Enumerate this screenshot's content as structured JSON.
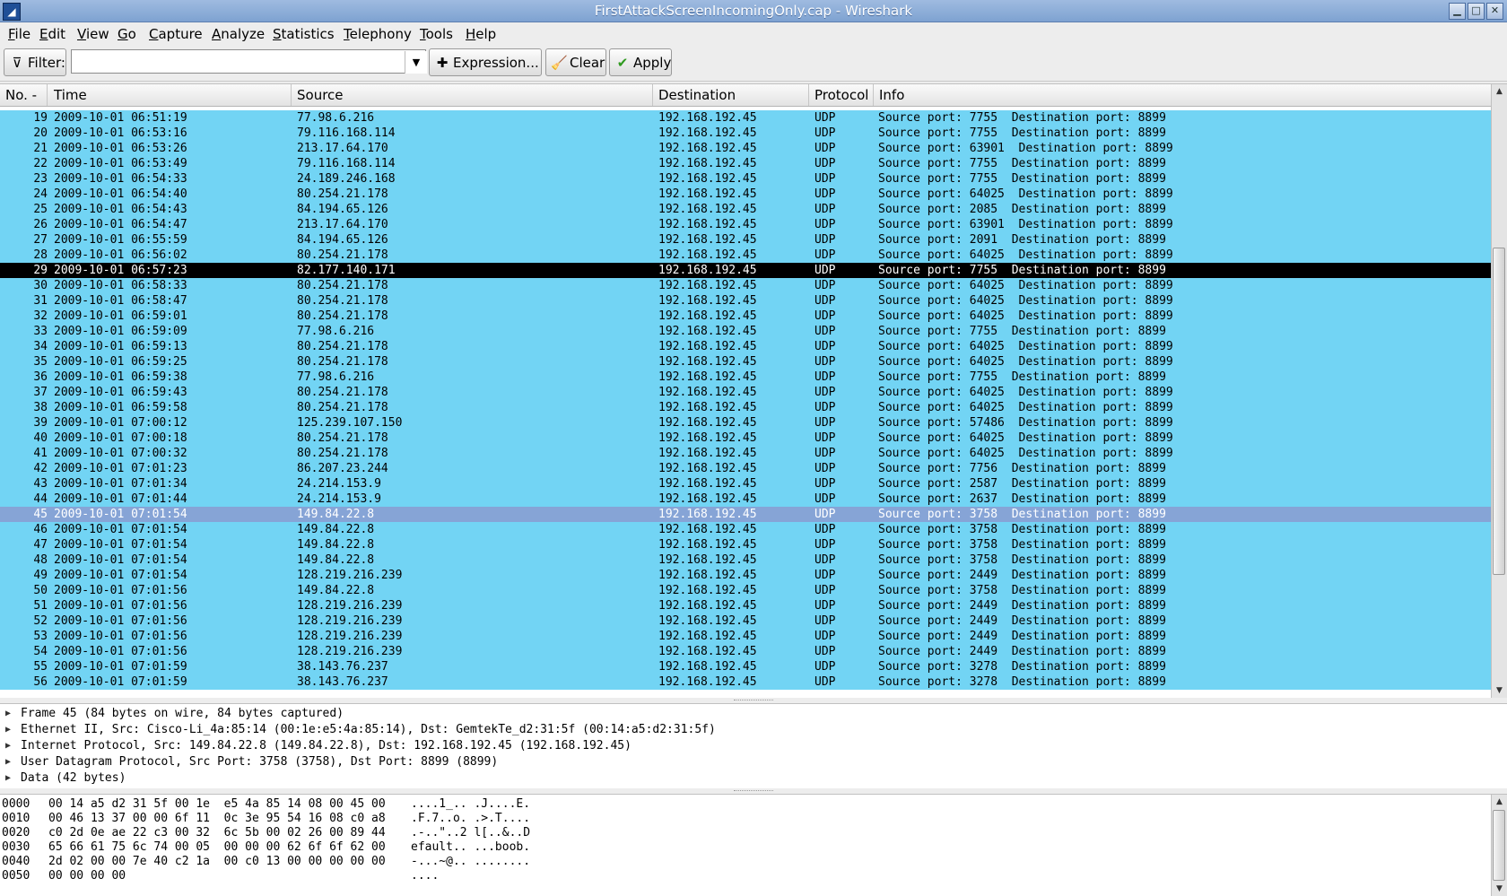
{
  "window": {
    "title": "FirstAttackScreenIncomingOnly.cap - Wireshark",
    "app_icon": "wireshark-icon",
    "buttons": [
      "minimize-icon",
      "maximize-icon",
      "close-icon"
    ]
  },
  "menu": [
    "File",
    "Edit",
    "View",
    "Go",
    "Capture",
    "Analyze",
    "Statistics",
    "Telephony",
    "Tools",
    "Help"
  ],
  "toolbar": {
    "filter_label": "Filter:",
    "filter_value": "",
    "expression_label": "Expression...",
    "clear_label": "Clear",
    "apply_label": "Apply"
  },
  "columns": [
    "No. -",
    "Time",
    "Source",
    "Destination",
    "Protocol",
    "Info"
  ],
  "colors": {
    "row": "#72d4f4",
    "selected": "#000000",
    "highlight": "#86a4d6"
  },
  "packets": [
    {
      "no": "19",
      "time": "2009-10-01 06:51:19",
      "src": "77.98.6.216",
      "dst": "192.168.192.45",
      "proto": "UDP",
      "info": "Source port: 7755  Destination port: 8899"
    },
    {
      "no": "20",
      "time": "2009-10-01 06:53:16",
      "src": "79.116.168.114",
      "dst": "192.168.192.45",
      "proto": "UDP",
      "info": "Source port: 7755  Destination port: 8899"
    },
    {
      "no": "21",
      "time": "2009-10-01 06:53:26",
      "src": "213.17.64.170",
      "dst": "192.168.192.45",
      "proto": "UDP",
      "info": "Source port: 63901  Destination port: 8899"
    },
    {
      "no": "22",
      "time": "2009-10-01 06:53:49",
      "src": "79.116.168.114",
      "dst": "192.168.192.45",
      "proto": "UDP",
      "info": "Source port: 7755  Destination port: 8899"
    },
    {
      "no": "23",
      "time": "2009-10-01 06:54:33",
      "src": "24.189.246.168",
      "dst": "192.168.192.45",
      "proto": "UDP",
      "info": "Source port: 7755  Destination port: 8899"
    },
    {
      "no": "24",
      "time": "2009-10-01 06:54:40",
      "src": "80.254.21.178",
      "dst": "192.168.192.45",
      "proto": "UDP",
      "info": "Source port: 64025  Destination port: 8899"
    },
    {
      "no": "25",
      "time": "2009-10-01 06:54:43",
      "src": "84.194.65.126",
      "dst": "192.168.192.45",
      "proto": "UDP",
      "info": "Source port: 2085  Destination port: 8899"
    },
    {
      "no": "26",
      "time": "2009-10-01 06:54:47",
      "src": "213.17.64.170",
      "dst": "192.168.192.45",
      "proto": "UDP",
      "info": "Source port: 63901  Destination port: 8899"
    },
    {
      "no": "27",
      "time": "2009-10-01 06:55:59",
      "src": "84.194.65.126",
      "dst": "192.168.192.45",
      "proto": "UDP",
      "info": "Source port: 2091  Destination port: 8899"
    },
    {
      "no": "28",
      "time": "2009-10-01 06:56:02",
      "src": "80.254.21.178",
      "dst": "192.168.192.45",
      "proto": "UDP",
      "info": "Source port: 64025  Destination port: 8899"
    },
    {
      "no": "29",
      "time": "2009-10-01 06:57:23",
      "src": "82.177.140.171",
      "dst": "192.168.192.45",
      "proto": "UDP",
      "info": "Source port: 7755  Destination port: 8899",
      "state": "sel"
    },
    {
      "no": "30",
      "time": "2009-10-01 06:58:33",
      "src": "80.254.21.178",
      "dst": "192.168.192.45",
      "proto": "UDP",
      "info": "Source port: 64025  Destination port: 8899"
    },
    {
      "no": "31",
      "time": "2009-10-01 06:58:47",
      "src": "80.254.21.178",
      "dst": "192.168.192.45",
      "proto": "UDP",
      "info": "Source port: 64025  Destination port: 8899"
    },
    {
      "no": "32",
      "time": "2009-10-01 06:59:01",
      "src": "80.254.21.178",
      "dst": "192.168.192.45",
      "proto": "UDP",
      "info": "Source port: 64025  Destination port: 8899"
    },
    {
      "no": "33",
      "time": "2009-10-01 06:59:09",
      "src": "77.98.6.216",
      "dst": "192.168.192.45",
      "proto": "UDP",
      "info": "Source port: 7755  Destination port: 8899"
    },
    {
      "no": "34",
      "time": "2009-10-01 06:59:13",
      "src": "80.254.21.178",
      "dst": "192.168.192.45",
      "proto": "UDP",
      "info": "Source port: 64025  Destination port: 8899"
    },
    {
      "no": "35",
      "time": "2009-10-01 06:59:25",
      "src": "80.254.21.178",
      "dst": "192.168.192.45",
      "proto": "UDP",
      "info": "Source port: 64025  Destination port: 8899"
    },
    {
      "no": "36",
      "time": "2009-10-01 06:59:38",
      "src": "77.98.6.216",
      "dst": "192.168.192.45",
      "proto": "UDP",
      "info": "Source port: 7755  Destination port: 8899"
    },
    {
      "no": "37",
      "time": "2009-10-01 06:59:43",
      "src": "80.254.21.178",
      "dst": "192.168.192.45",
      "proto": "UDP",
      "info": "Source port: 64025  Destination port: 8899"
    },
    {
      "no": "38",
      "time": "2009-10-01 06:59:58",
      "src": "80.254.21.178",
      "dst": "192.168.192.45",
      "proto": "UDP",
      "info": "Source port: 64025  Destination port: 8899"
    },
    {
      "no": "39",
      "time": "2009-10-01 07:00:12",
      "src": "125.239.107.150",
      "dst": "192.168.192.45",
      "proto": "UDP",
      "info": "Source port: 57486  Destination port: 8899"
    },
    {
      "no": "40",
      "time": "2009-10-01 07:00:18",
      "src": "80.254.21.178",
      "dst": "192.168.192.45",
      "proto": "UDP",
      "info": "Source port: 64025  Destination port: 8899"
    },
    {
      "no": "41",
      "time": "2009-10-01 07:00:32",
      "src": "80.254.21.178",
      "dst": "192.168.192.45",
      "proto": "UDP",
      "info": "Source port: 64025  Destination port: 8899"
    },
    {
      "no": "42",
      "time": "2009-10-01 07:01:23",
      "src": "86.207.23.244",
      "dst": "192.168.192.45",
      "proto": "UDP",
      "info": "Source port: 7756  Destination port: 8899"
    },
    {
      "no": "43",
      "time": "2009-10-01 07:01:34",
      "src": "24.214.153.9",
      "dst": "192.168.192.45",
      "proto": "UDP",
      "info": "Source port: 2587  Destination port: 8899"
    },
    {
      "no": "44",
      "time": "2009-10-01 07:01:44",
      "src": "24.214.153.9",
      "dst": "192.168.192.45",
      "proto": "UDP",
      "info": "Source port: 2637  Destination port: 8899"
    },
    {
      "no": "45",
      "time": "2009-10-01 07:01:54",
      "src": "149.84.22.8",
      "dst": "192.168.192.45",
      "proto": "UDP",
      "info": "Source port: 3758  Destination port: 8899",
      "state": "hl"
    },
    {
      "no": "46",
      "time": "2009-10-01 07:01:54",
      "src": "149.84.22.8",
      "dst": "192.168.192.45",
      "proto": "UDP",
      "info": "Source port: 3758  Destination port: 8899"
    },
    {
      "no": "47",
      "time": "2009-10-01 07:01:54",
      "src": "149.84.22.8",
      "dst": "192.168.192.45",
      "proto": "UDP",
      "info": "Source port: 3758  Destination port: 8899"
    },
    {
      "no": "48",
      "time": "2009-10-01 07:01:54",
      "src": "149.84.22.8",
      "dst": "192.168.192.45",
      "proto": "UDP",
      "info": "Source port: 3758  Destination port: 8899"
    },
    {
      "no": "49",
      "time": "2009-10-01 07:01:54",
      "src": "128.219.216.239",
      "dst": "192.168.192.45",
      "proto": "UDP",
      "info": "Source port: 2449  Destination port: 8899"
    },
    {
      "no": "50",
      "time": "2009-10-01 07:01:56",
      "src": "149.84.22.8",
      "dst": "192.168.192.45",
      "proto": "UDP",
      "info": "Source port: 3758  Destination port: 8899"
    },
    {
      "no": "51",
      "time": "2009-10-01 07:01:56",
      "src": "128.219.216.239",
      "dst": "192.168.192.45",
      "proto": "UDP",
      "info": "Source port: 2449  Destination port: 8899"
    },
    {
      "no": "52",
      "time": "2009-10-01 07:01:56",
      "src": "128.219.216.239",
      "dst": "192.168.192.45",
      "proto": "UDP",
      "info": "Source port: 2449  Destination port: 8899"
    },
    {
      "no": "53",
      "time": "2009-10-01 07:01:56",
      "src": "128.219.216.239",
      "dst": "192.168.192.45",
      "proto": "UDP",
      "info": "Source port: 2449  Destination port: 8899"
    },
    {
      "no": "54",
      "time": "2009-10-01 07:01:56",
      "src": "128.219.216.239",
      "dst": "192.168.192.45",
      "proto": "UDP",
      "info": "Source port: 2449  Destination port: 8899"
    },
    {
      "no": "55",
      "time": "2009-10-01 07:01:59",
      "src": "38.143.76.237",
      "dst": "192.168.192.45",
      "proto": "UDP",
      "info": "Source port: 3278  Destination port: 8899"
    },
    {
      "no": "56",
      "time": "2009-10-01 07:01:59",
      "src": "38.143.76.237",
      "dst": "192.168.192.45",
      "proto": "UDP",
      "info": "Source port: 3278  Destination port: 8899"
    }
  ],
  "details": [
    "Frame 45 (84 bytes on wire, 84 bytes captured)",
    "Ethernet II, Src: Cisco-Li_4a:85:14 (00:1e:e5:4a:85:14), Dst: GemtekTe_d2:31:5f (00:14:a5:d2:31:5f)",
    "Internet Protocol, Src: 149.84.22.8 (149.84.22.8), Dst: 192.168.192.45 (192.168.192.45)",
    "User Datagram Protocol, Src Port: 3758 (3758), Dst Port: 8899 (8899)",
    "Data (42 bytes)"
  ],
  "hex": [
    {
      "off": "0000",
      "bytes": "00 14 a5 d2 31 5f 00 1e  e5 4a 85 14 08 00 45 00",
      "ascii": "....1_.. .J....E."
    },
    {
      "off": "0010",
      "bytes": "00 46 13 37 00 00 6f 11  0c 3e 95 54 16 08 c0 a8",
      "ascii": ".F.7..o. .>.T...."
    },
    {
      "off": "0020",
      "bytes": "c0 2d 0e ae 22 c3 00 32  6c 5b 00 02 26 00 89 44",
      "ascii": ".-..\"..2 l[..&..D"
    },
    {
      "off": "0030",
      "bytes": "65 66 61 75 6c 74 00 05  00 00 00 62 6f 6f 62 00",
      "ascii": "efault.. ...boob."
    },
    {
      "off": "0040",
      "bytes": "2d 02 00 00 7e 40 c2 1a  00 c0 13 00 00 00 00 00",
      "ascii": "-...~@.. ........"
    },
    {
      "off": "0050",
      "bytes": "00 00 00 00",
      "ascii": "...."
    }
  ]
}
